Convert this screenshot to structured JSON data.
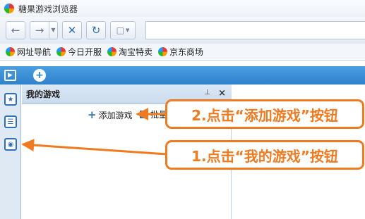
{
  "window": {
    "title": "糖果游戏浏览器"
  },
  "toolbar": {
    "back_icon": "arrow-left-icon",
    "forward_icon": "arrow-right-icon",
    "stop_icon": "close-icon",
    "refresh_icon": "refresh-icon",
    "newpage_icon": "page-icon",
    "address_value": ""
  },
  "bookmarks": [
    {
      "label": "网址导航"
    },
    {
      "label": "今日开服"
    },
    {
      "label": "淘宝特卖"
    },
    {
      "label": "京东商场"
    }
  ],
  "tabs": {
    "add_label": "+"
  },
  "panel": {
    "title": "我的游戏",
    "pin_label": "ᵖ",
    "close_label": "×",
    "add_game_label": "添加游戏",
    "batch_label": "批量"
  },
  "callouts": {
    "step2": "2.点击“添加游戏”按钮",
    "step1": "1.点击“我的游戏”按钮"
  },
  "colors": {
    "accent": "#f07a1f",
    "tab_blue": "#2f82cc",
    "icon_blue": "#2f6fb2"
  }
}
